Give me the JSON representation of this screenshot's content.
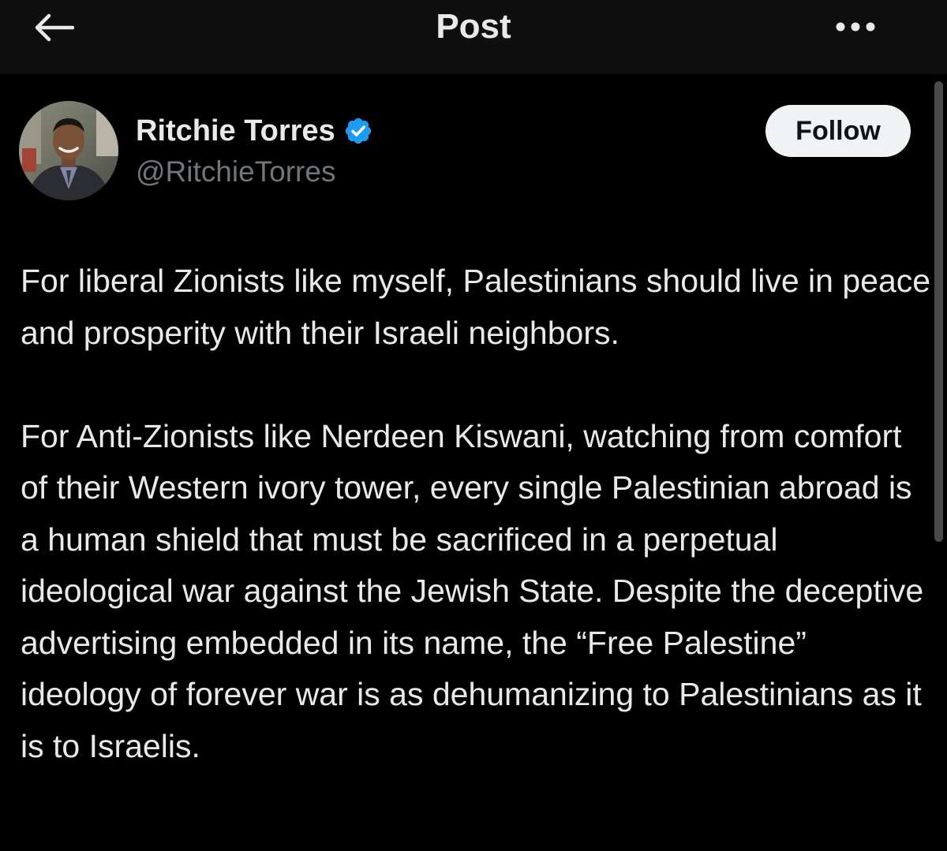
{
  "header": {
    "title": "Post",
    "back_icon": "arrow-left-icon",
    "more_icon": "more-horizontal-icon"
  },
  "author": {
    "name": "Ritchie Torres",
    "handle": "@RitchieTorres",
    "verified_icon": "verified-badge-icon",
    "verified_color": "#1d9bf0"
  },
  "follow_button": {
    "label": "Follow"
  },
  "post": {
    "paragraphs": [
      "For liberal Zionists like myself, Palestinians should live in peace and prosperity with their Israeli neighbors.",
      "For Anti-Zionists like Nerdeen Kiswani, watching from comfort of their Western ivory tower, every single Palestinian abroad is a human shield that must be sacrificed in a perpetual ideological war against the Jewish State.  Despite the deceptive advertising embedded in its name, the “Free Palestine” ideology of forever war is as dehumanizing to Palestinians as it is to Israelis."
    ]
  },
  "colors": {
    "background": "#000000",
    "header_background": "#0f0f0f",
    "text_primary": "#e7e9ea",
    "text_secondary": "#71767b",
    "follow_bg": "#eff3f4",
    "follow_text": "#0f1419"
  }
}
